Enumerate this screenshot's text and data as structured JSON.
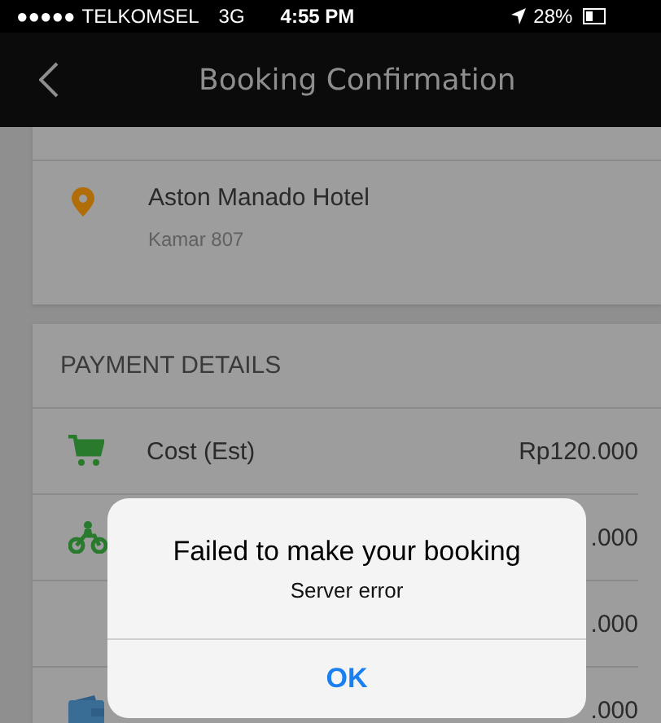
{
  "status_bar": {
    "signal": "●●●●●",
    "carrier": "TELKOMSEL",
    "network": "3G",
    "time": "4:55 PM",
    "battery": "28%"
  },
  "nav": {
    "title": "Booking Confirmation"
  },
  "delivery": {
    "place": "Aston Manado Hotel",
    "note": "Kamar 807"
  },
  "payment": {
    "title": "PAYMENT DETAILS",
    "rows": [
      {
        "kind": "cart",
        "label": "Cost (Est)",
        "amount": "Rp120.000"
      },
      {
        "kind": "motorbike",
        "amount": ".000"
      },
      {
        "kind": "none",
        "amount": ".000"
      },
      {
        "kind": "wallet",
        "amount": ".000"
      }
    ]
  },
  "dialog": {
    "title": "Failed to make your booking",
    "message": "Server error",
    "button": "OK"
  }
}
